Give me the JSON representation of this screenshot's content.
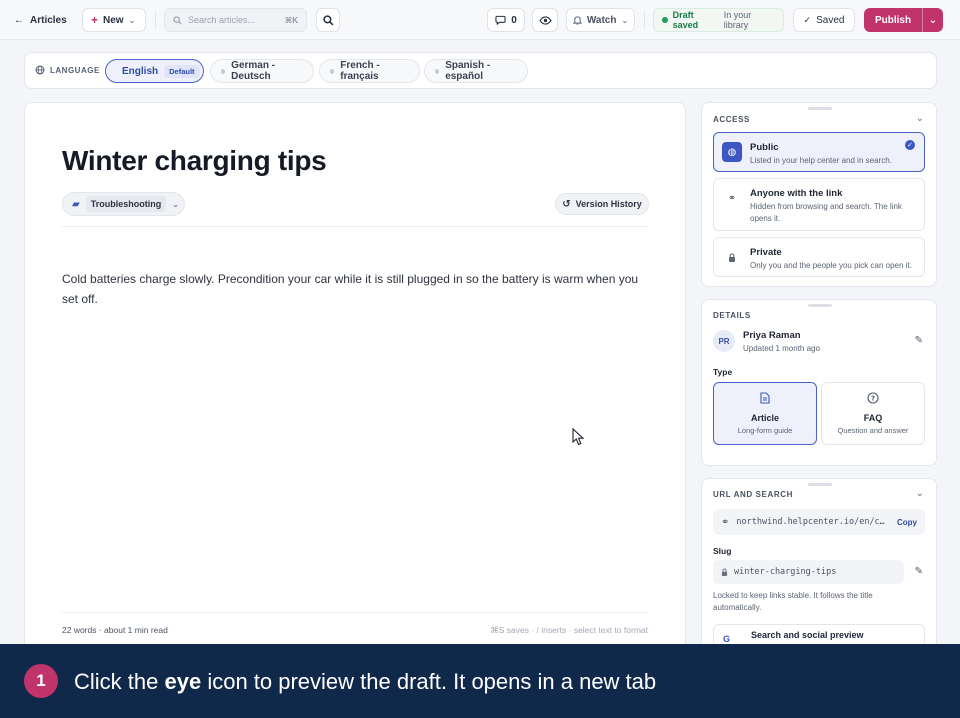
{
  "topbar": {
    "back_label": "Articles",
    "new_label": "New",
    "search_placeholder": "Search articles...",
    "search_shortcut": "⌘K",
    "comment_count": "0",
    "watch_label": "Watch",
    "draft_status": "Draft saved",
    "draft_location": "In your library",
    "saved_label": "Saved",
    "publish_label": "Publish"
  },
  "language_bar": {
    "label": "LANGUAGE",
    "languages": [
      {
        "name": "English",
        "badge": "Default",
        "active": true
      },
      {
        "name": "German - Deutsch"
      },
      {
        "name": "French - français"
      },
      {
        "name": "Spanish - español"
      }
    ]
  },
  "editor": {
    "title": "Winter charging tips",
    "folder": "Troubleshooting",
    "version_history_label": "Version History",
    "body": "Cold batteries charge slowly. Precondition your car while it is still plugged in so the battery is warm when you set off.",
    "word_count": "22 words · about 1 min read",
    "shortcut_hint": "⌘S saves · / inserts · select text to format"
  },
  "access": {
    "title": "ACCESS",
    "options": [
      {
        "label": "Public",
        "description": "Listed in your help center and in search.",
        "selected": true
      },
      {
        "label": "Anyone with the link",
        "description": "Hidden from browsing and search. The link opens it."
      },
      {
        "label": "Private",
        "description": "Only you and the people you pick can open it."
      }
    ]
  },
  "details": {
    "title": "DETAILS",
    "author_initials": "PR",
    "author_name": "Priya Raman",
    "updated": "Updated 1 month ago",
    "type_label": "Type",
    "types": [
      {
        "name": "Article",
        "description": "Long-form guide",
        "selected": true
      },
      {
        "name": "FAQ",
        "description": "Question and answer"
      }
    ]
  },
  "url_search": {
    "title": "URL AND SEARCH",
    "url": "northwind.helpcenter.io/en/c…",
    "copy_label": "Copy",
    "slug_label": "Slug",
    "slug": "winter-charging-tips",
    "slug_note": "Locked to keep links stable. It follows the title automatically.",
    "seo_label": "Search and social preview"
  },
  "caption": {
    "step": "1",
    "text_before": "Click the ",
    "text_bold": "eye",
    "text_after": " icon to preview the draft. It opens in a new tab"
  },
  "colors": {
    "accent": "#4962c6",
    "publish": "#c1336b",
    "caption_bg": "#10284a",
    "draft_green": "#1f9d5a"
  }
}
